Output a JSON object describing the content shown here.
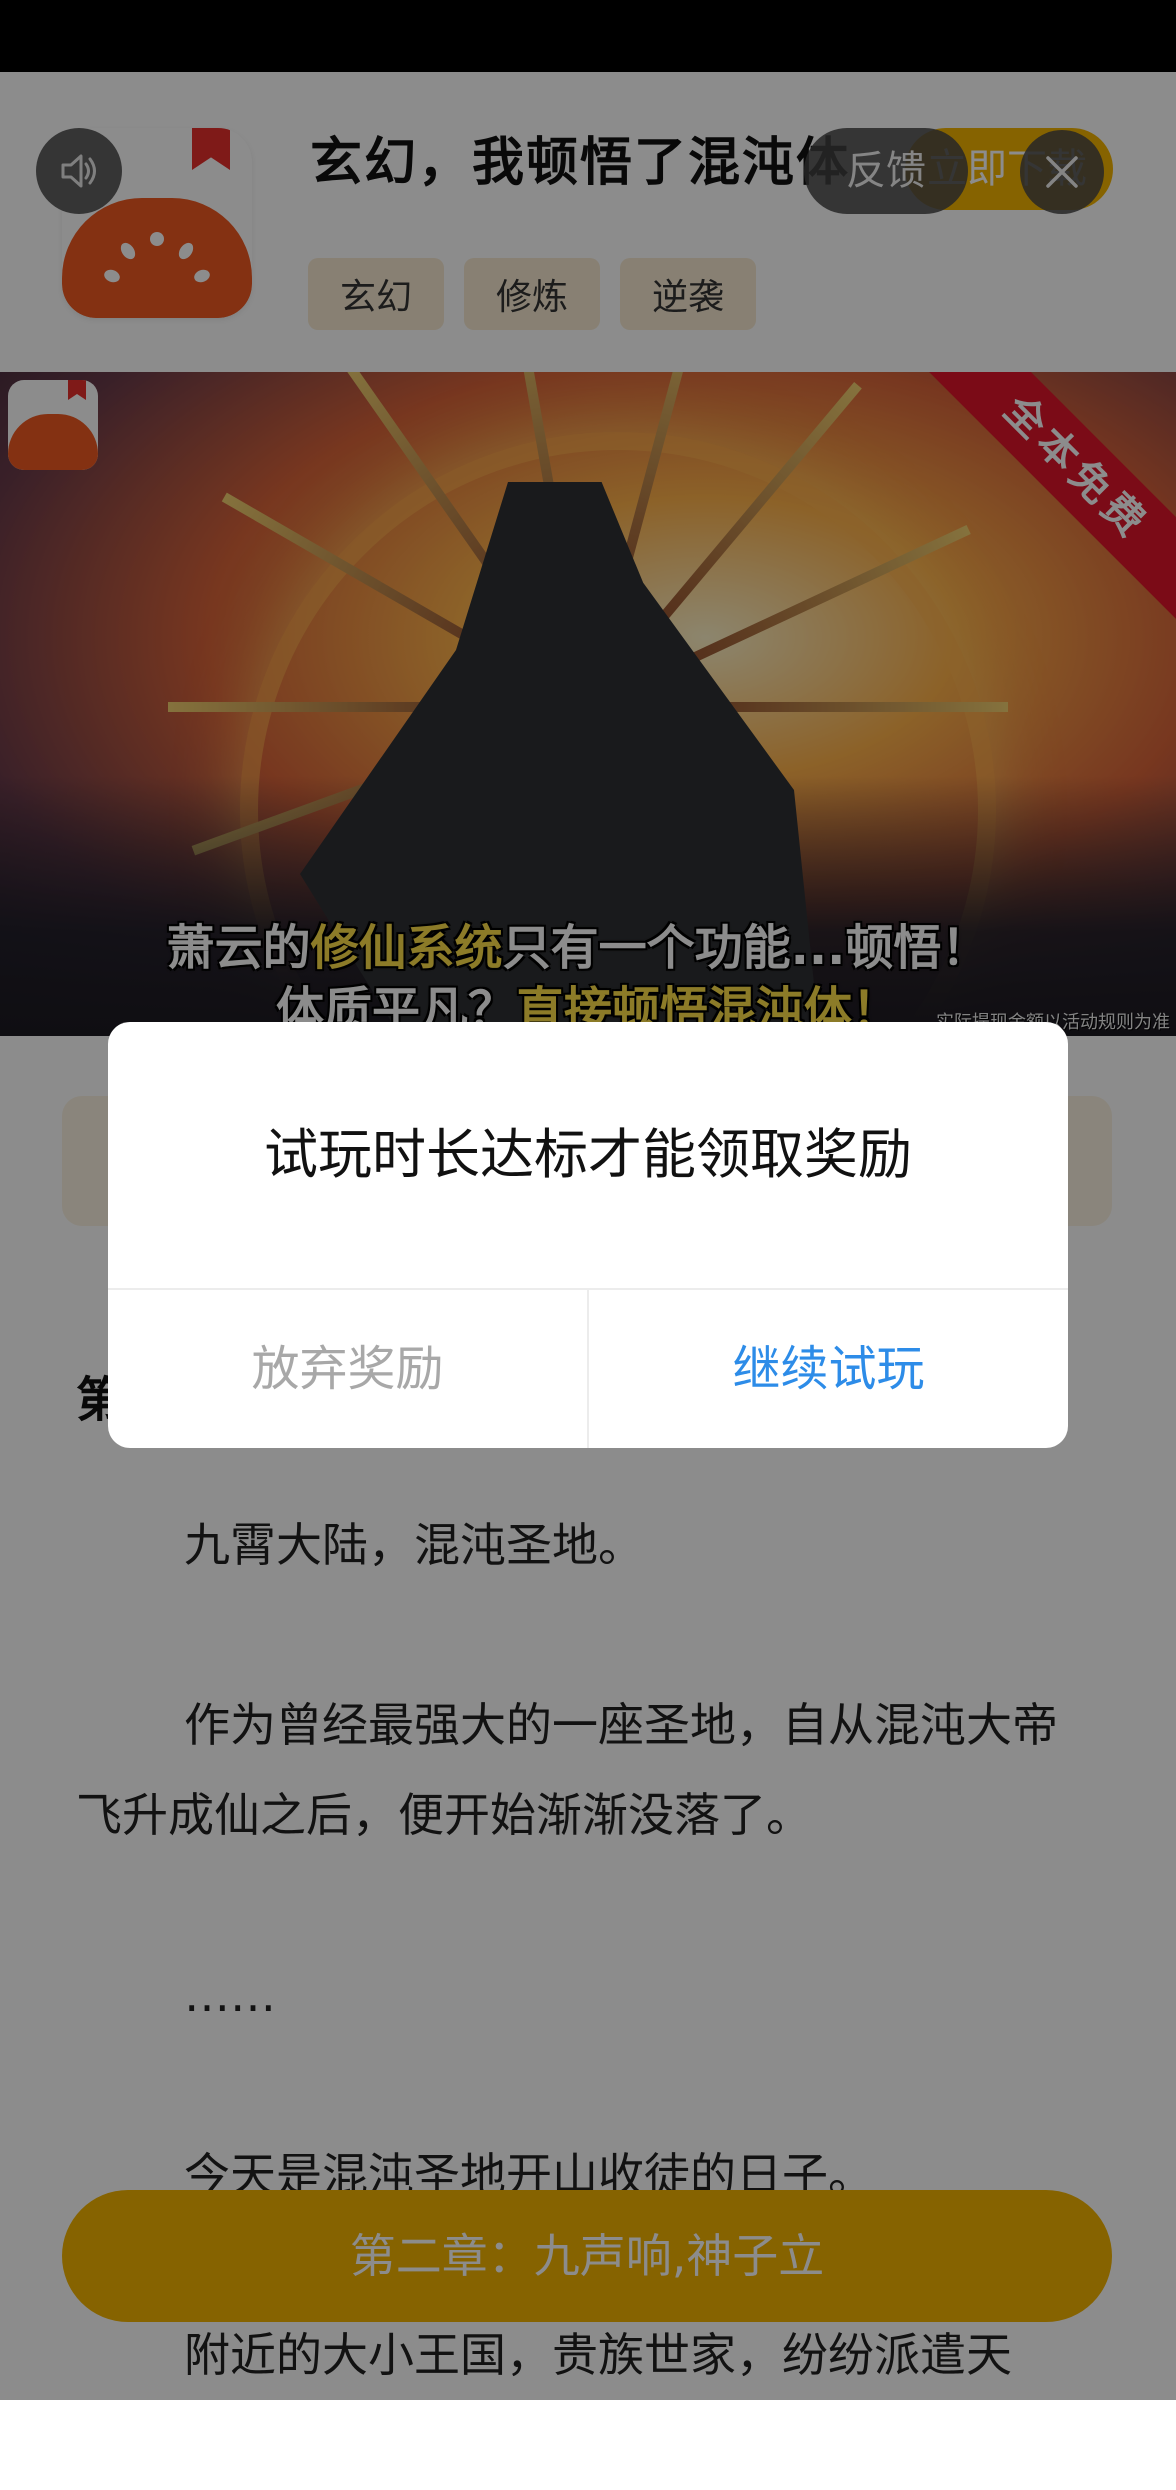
{
  "header": {
    "title": "玄幻，我顿悟了混沌体",
    "tags": [
      "玄幻",
      "修炼",
      "逆袭"
    ],
    "download_label": "立即下载",
    "feedback_label": "反馈"
  },
  "banner": {
    "ribbon": "全本免费",
    "line1_a": "萧云的",
    "line1_b": "修仙系统",
    "line1_c": "只有一个功能...顿悟！",
    "line2_a": "体质平凡？",
    "line2_b": "直接顿悟混沌体！",
    "disclaimer": "实际提现金额以活动规则为准"
  },
  "article": {
    "chapter_partial": "第",
    "paragraphs": [
      "九霄大陆，混沌圣地。",
      "作为曾经最强大的一座圣地，自从混沌大帝飞升成仙之后，便开始渐渐没落了。",
      "……",
      "今天是混沌圣地开山收徒的日子。",
      "附近的大小王国，贵族世家，纷纷派遣天"
    ]
  },
  "bottom_cta": {
    "label": "第二章：九声响,神子立"
  },
  "dialog": {
    "message": "试玩时长达标才能领取奖励",
    "cancel_label": "放弃奖励",
    "confirm_label": "继续试玩"
  },
  "colors": {
    "accent_yellow": "#f4b500",
    "confirm_blue": "#2d8ce8",
    "cancel_gray": "#a8a8a8",
    "ribbon_red": "#e0142a"
  },
  "icons": {
    "sound": "speaker-icon",
    "close": "close-icon",
    "app": "tomato-novel-logo"
  }
}
